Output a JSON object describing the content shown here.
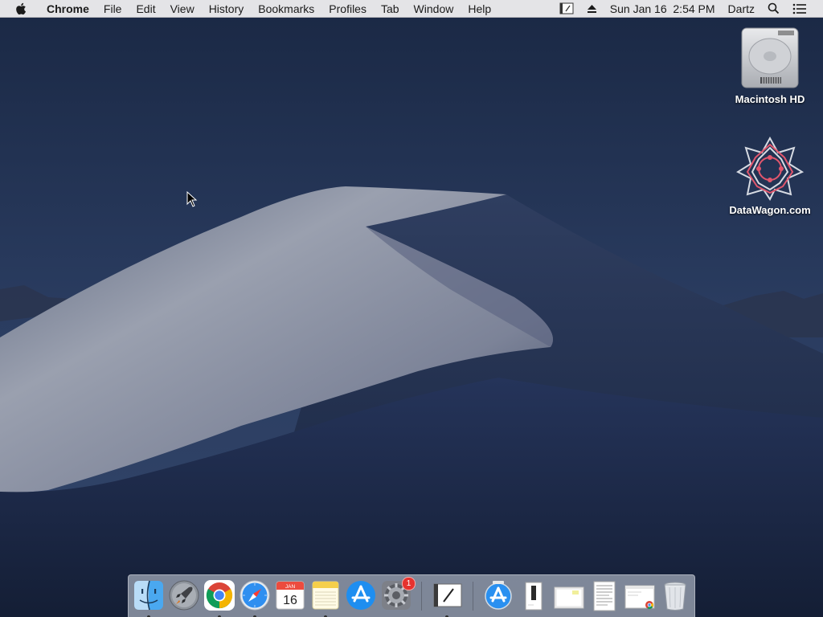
{
  "menubar": {
    "app_name": "Chrome",
    "items": [
      "File",
      "Edit",
      "View",
      "History",
      "Bookmarks",
      "Profiles",
      "Tab",
      "Window",
      "Help"
    ],
    "datetime": "Sun Jan 16  2:54 PM",
    "user": "Dartz"
  },
  "desktop": {
    "icons": [
      {
        "label": "Macintosh HD",
        "icon": "hard-drive-icon"
      },
      {
        "label": "DataWagon.com",
        "icon": "datawagon-logo-icon"
      }
    ]
  },
  "dock": {
    "apps": [
      {
        "name": "Finder",
        "icon": "finder-icon",
        "running": true
      },
      {
        "name": "Launchpad",
        "icon": "launchpad-icon",
        "running": false
      },
      {
        "name": "Google Chrome",
        "icon": "chrome-icon",
        "running": true
      },
      {
        "name": "Safari",
        "icon": "safari-icon",
        "running": true
      },
      {
        "name": "Calendar",
        "icon": "calendar-icon",
        "running": false
      },
      {
        "name": "Notes",
        "icon": "notes-icon",
        "running": true
      },
      {
        "name": "App Store",
        "icon": "app-store-icon",
        "running": false
      },
      {
        "name": "System Preferences",
        "icon": "system-preferences-icon",
        "running": false
      },
      {
        "name": "Script Editor",
        "icon": "script-editor-icon",
        "running": true
      }
    ],
    "calendar": {
      "month": "JAN",
      "day": "16"
    },
    "system_preferences_badge": "1"
  },
  "colors": {
    "sky_top": "#1b2a45",
    "dune_light": "#8e94a4",
    "dune_dark": "#22304f",
    "badge_red": "#e6322e"
  }
}
